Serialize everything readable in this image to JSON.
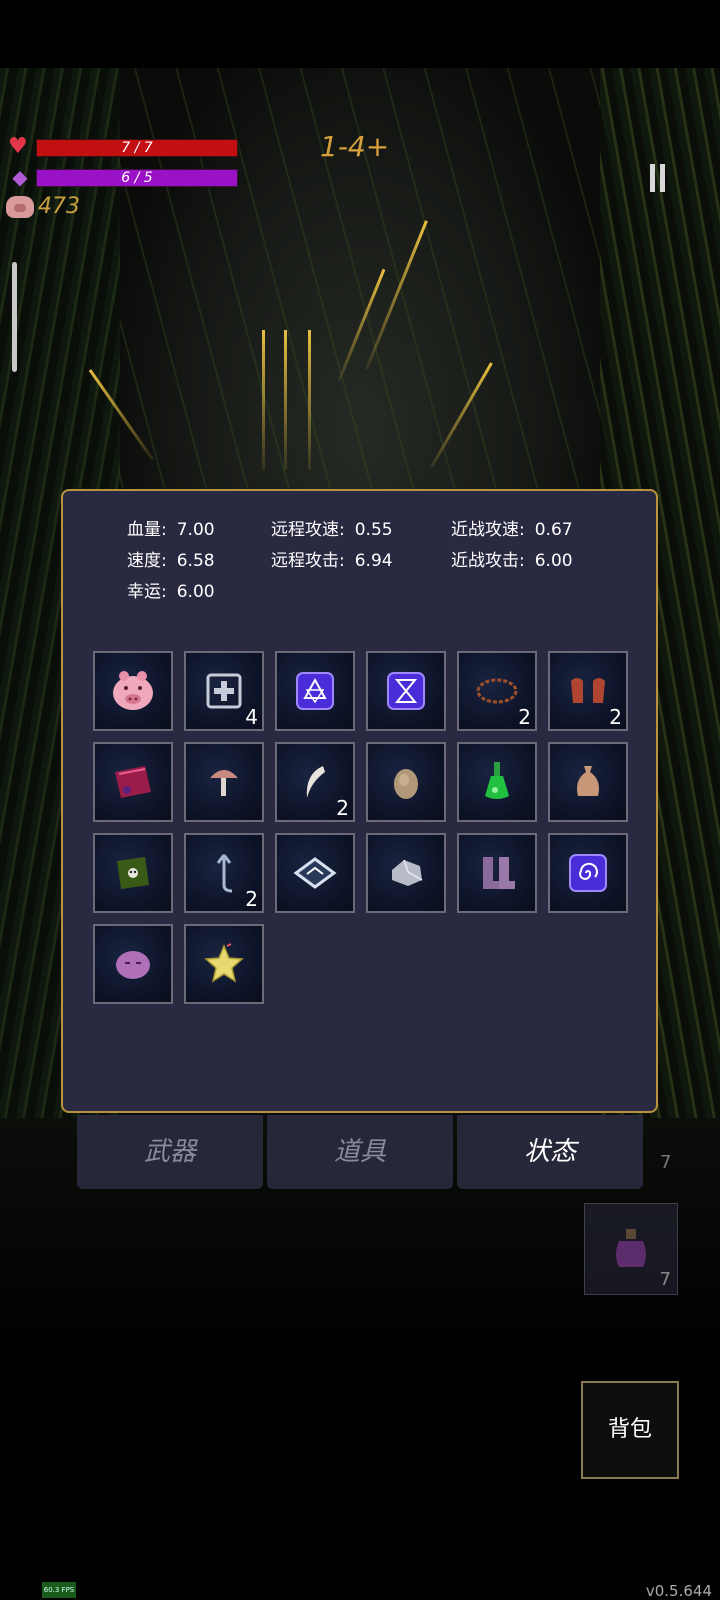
{
  "hud": {
    "hp_text": "7 / 7",
    "hp_fraction": 1.0,
    "mp_text": "6 / 5",
    "mp_fraction": 1.0,
    "coins": "473",
    "level": "1-4+"
  },
  "stats": [
    {
      "label": "血量:",
      "value": "7.00"
    },
    {
      "label": "远程攻速:",
      "value": "0.55"
    },
    {
      "label": "近战攻速:",
      "value": "0.67"
    },
    {
      "label": "速度:",
      "value": "6.58"
    },
    {
      "label": "远程攻击:",
      "value": "6.94"
    },
    {
      "label": "近战攻击:",
      "value": "6.00"
    },
    {
      "label": "幸运:",
      "value": "6.00"
    }
  ],
  "items": [
    {
      "icon": "piggy-bank-icon",
      "count": ""
    },
    {
      "icon": "heal-box-icon",
      "count": "4"
    },
    {
      "icon": "rune-triangle-icon",
      "count": ""
    },
    {
      "icon": "rune-hourglass-icon",
      "count": ""
    },
    {
      "icon": "thorn-crown-icon",
      "count": "2"
    },
    {
      "icon": "red-gloves-icon",
      "count": "2"
    },
    {
      "icon": "spellbook-red-icon",
      "count": ""
    },
    {
      "icon": "mushroom-icon",
      "count": ""
    },
    {
      "icon": "fang-icon",
      "count": "2"
    },
    {
      "icon": "egg-icon",
      "count": ""
    },
    {
      "icon": "green-potion-icon",
      "count": ""
    },
    {
      "icon": "sack-icon",
      "count": ""
    },
    {
      "icon": "skull-book-icon",
      "count": ""
    },
    {
      "icon": "anchor-hook-icon",
      "count": "2"
    },
    {
      "icon": "diamond-plate-icon",
      "count": ""
    },
    {
      "icon": "silver-ore-icon",
      "count": ""
    },
    {
      "icon": "purple-boots-icon",
      "count": ""
    },
    {
      "icon": "rune-spiral-icon",
      "count": ""
    },
    {
      "icon": "pink-slime-icon",
      "count": ""
    },
    {
      "icon": "star-gem-icon",
      "count": ""
    }
  ],
  "tabs": {
    "weapons": "武器",
    "props": "道具",
    "status": "状态"
  },
  "side": {
    "top_count": "7",
    "slot_count": "7"
  },
  "bag_label": "背包",
  "fps": "60.3 FPS",
  "version": "v0.5.644"
}
